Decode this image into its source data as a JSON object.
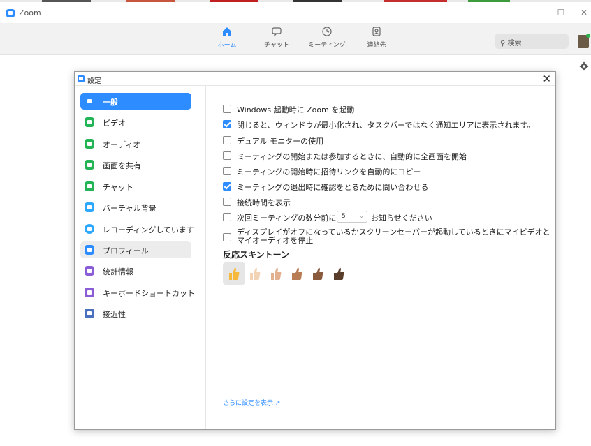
{
  "window": {
    "title": "Zoom",
    "controls": [
      "–",
      "☐",
      "✕"
    ]
  },
  "nav": {
    "items": [
      {
        "label": "ホーム",
        "icon": "home-icon",
        "active": true
      },
      {
        "label": "チャット",
        "icon": "chat-icon",
        "active": false
      },
      {
        "label": "ミーティング",
        "icon": "clock-icon",
        "active": false
      },
      {
        "label": "連絡先",
        "icon": "contacts-icon",
        "active": false
      }
    ],
    "search_placeholder": "検索"
  },
  "settings": {
    "title": "設定",
    "close": "✕",
    "sidebar": [
      {
        "label": "一般",
        "icon": "gear-icon",
        "color": "#2D8CFF",
        "active": true
      },
      {
        "label": "ビデオ",
        "icon": "video-icon",
        "color": "#23b455"
      },
      {
        "label": "オーディオ",
        "icon": "headphone-icon",
        "color": "#23b455"
      },
      {
        "label": "画面を共有",
        "icon": "share-screen-icon",
        "color": "#23b455"
      },
      {
        "label": "チャット",
        "icon": "chat-icon",
        "color": "#23b455"
      },
      {
        "label": "バーチャル背景",
        "icon": "virtual-background-icon",
        "color": "#2da8ff"
      },
      {
        "label": "レコーディングしています",
        "icon": "recording-icon",
        "color": "#2da8ff"
      },
      {
        "label": "プロフィール",
        "icon": "profile-icon",
        "color": "#2D8CFF",
        "hover": true
      },
      {
        "label": "統計情報",
        "icon": "statistics-icon",
        "color": "#8a5cd6"
      },
      {
        "label": "キーボードショートカット",
        "icon": "keyboard-icon",
        "color": "#8a5cd6"
      },
      {
        "label": "接近性",
        "icon": "accessibility-icon",
        "color": "#4a6fbf"
      }
    ],
    "options": [
      {
        "label": "Windows 起動時に Zoom を起動",
        "checked": false
      },
      {
        "label": "閉じると、ウィンドウが最小化され、タスクバーではなく通知エリアに表示されます。",
        "checked": true
      },
      {
        "label": "デュアル モニターの使用",
        "checked": false
      },
      {
        "label": "ミーティングの開始または参加するときに、自動的に全画面を開始",
        "checked": false
      },
      {
        "label": "ミーティングの開始時に招待リンクを自動的にコピー",
        "checked": false
      },
      {
        "label": "ミーティングの退出時に確認をとるために問い合わせる",
        "checked": true
      },
      {
        "label": "接続時間を表示",
        "checked": false
      }
    ],
    "reminder": {
      "before": "次回ミーティングの数分前に",
      "minutes": "5",
      "after": "お知らせください",
      "checked": false
    },
    "screensaver": {
      "label": "ディスプレイがオフになっているかスクリーンセーバーが起動しているときにマイビデオとマイオーディオを停止",
      "checked": false
    },
    "skin_tone_title": "反応スキントーン",
    "skin_tones": [
      "#f6b93b",
      "#f3d3b5",
      "#e3b08d",
      "#b97d55",
      "#8a5a3c",
      "#5b3d2c"
    ],
    "more_settings": "さらに設定を表示"
  }
}
